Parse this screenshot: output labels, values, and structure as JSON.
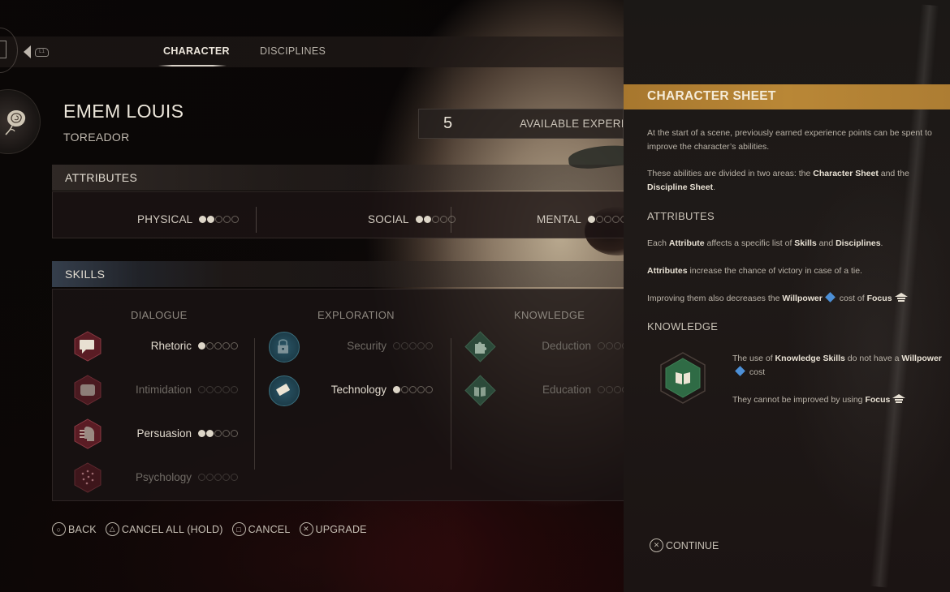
{
  "tabs": {
    "nav_button": "L1",
    "items": [
      {
        "label": "CHARACTER",
        "active": true
      },
      {
        "label": "DISCIPLINES",
        "active": false
      }
    ]
  },
  "character": {
    "name": "EMEM LOUIS",
    "clan": "TOREADOR",
    "clan_icon": "rose-icon"
  },
  "experience": {
    "value": "5",
    "label": "AVAILABLE EXPERIENCE"
  },
  "attributes": {
    "title": "ATTRIBUTES",
    "items": [
      {
        "label": "PHYSICAL",
        "value": 2,
        "max": 5
      },
      {
        "label": "SOCIAL",
        "value": 2,
        "max": 5
      },
      {
        "label": "MENTAL",
        "value": 1,
        "max": 5
      }
    ]
  },
  "skills": {
    "title": "SKILLS",
    "columns": [
      {
        "label": "DIALOGUE",
        "items": [
          {
            "label": "Rhetoric",
            "value": 1,
            "max": 5,
            "icon": "speech-bubbles-icon"
          },
          {
            "label": "Intimidation",
            "value": 0,
            "max": 5,
            "icon": "fist-icon"
          },
          {
            "label": "Persuasion",
            "value": 2,
            "max": 5,
            "icon": "persuasion-head-icon"
          },
          {
            "label": "Psychology",
            "value": 0,
            "max": 5,
            "icon": "brain-network-icon"
          }
        ]
      },
      {
        "label": "EXPLORATION",
        "items": [
          {
            "label": "Security",
            "value": 0,
            "max": 5,
            "icon": "padlock-icon"
          },
          {
            "label": "Technology",
            "value": 1,
            "max": 5,
            "icon": "device-icon"
          }
        ]
      },
      {
        "label": "KNOWLEDGE",
        "items": [
          {
            "label": "Deduction",
            "value": 0,
            "max": 5,
            "icon": "puzzle-piece-icon"
          },
          {
            "label": "Education",
            "value": 0,
            "max": 5,
            "icon": "book-icon"
          }
        ]
      }
    ]
  },
  "hints": [
    {
      "glyph": "○",
      "icon": "circle-button-icon",
      "label": "BACK"
    },
    {
      "glyph": "△",
      "icon": "triangle-button-icon",
      "label": "CANCEL ALL (HOLD)"
    },
    {
      "glyph": "□",
      "icon": "square-button-icon",
      "label": "CANCEL"
    },
    {
      "glyph": "✕",
      "icon": "cross-button-icon",
      "label": "UPGRADE"
    }
  ],
  "help_panel": {
    "title": "CHARACTER SHEET",
    "intro_1": "At the start of a scene, previously earned experience points can be spent to improve the character’s abilities.",
    "intro_2_pre": "These abilities are divided in two areas: the ",
    "intro_2_b1": "Character Sheet",
    "intro_2_mid": " and the ",
    "intro_2_b2": "Discipline Sheet",
    "intro_2_post": ".",
    "attributes_title": "ATTRIBUTES",
    "attr_1_pre": "Each ",
    "attr_1_b1": "Attribute",
    "attr_1_mid1": " affects a specific list of ",
    "attr_1_b2": "Skills",
    "attr_1_mid2": " and ",
    "attr_1_b3": "Disciplines",
    "attr_1_post": ".",
    "attr_2_b": "Attributes",
    "attr_2_post": " increase the chance of victory in case of a tie.",
    "attr_3_pre": "Improving them also decreases the ",
    "attr_3_b1": "Willpower",
    "attr_3_mid": " cost of ",
    "attr_3_b2": "Focus",
    "knowledge_title": "KNOWLEDGE",
    "know_1_pre": "The use of ",
    "know_1_b1": "Knowledge Skills",
    "know_1_mid": " do not have a ",
    "know_1_b2": "Willpower",
    "know_1_post": " cost",
    "know_2_pre": "They cannot be improved by using ",
    "know_2_b": "Focus",
    "continue_glyph": "✕",
    "continue_label": "CONTINUE",
    "colors": {
      "header": "#b28232",
      "willpower": "#4c8fd6",
      "knowledge_green": "#2f6b45"
    }
  }
}
